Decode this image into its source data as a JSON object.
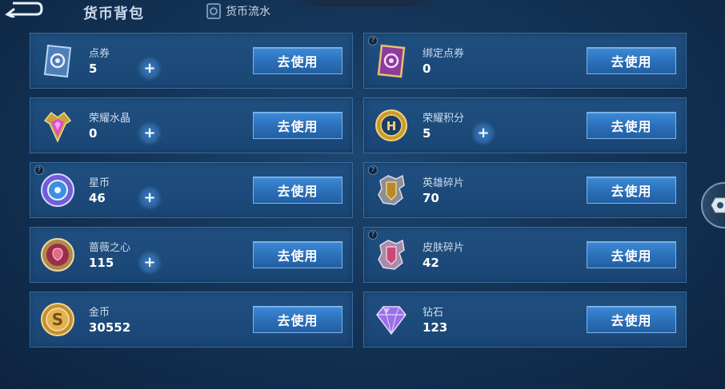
{
  "header": {
    "title": "货币背包",
    "flow_tab_label": "货币流水"
  },
  "use_label": "去使用",
  "currencies": [
    {
      "name": "点券",
      "amount": "5",
      "icon": "ticket-icon",
      "has_plus": true,
      "has_help": false
    },
    {
      "name": "绑定点券",
      "amount": "0",
      "icon": "bound-ticket-icon",
      "has_plus": false,
      "has_help": true
    },
    {
      "name": "荣耀水晶",
      "amount": "0",
      "icon": "glory-crystal-icon",
      "has_plus": true,
      "has_help": false
    },
    {
      "name": "荣耀积分",
      "amount": "5",
      "icon": "glory-points-icon",
      "has_plus": true,
      "has_help": false
    },
    {
      "name": "星币",
      "amount": "46",
      "icon": "star-coin-icon",
      "has_plus": true,
      "has_help": true
    },
    {
      "name": "英雄碎片",
      "amount": "70",
      "icon": "hero-shard-icon",
      "has_plus": false,
      "has_help": true
    },
    {
      "name": "蔷薇之心",
      "amount": "115",
      "icon": "rose-heart-icon",
      "has_plus": true,
      "has_help": false
    },
    {
      "name": "皮肤碎片",
      "amount": "42",
      "icon": "skin-shard-icon",
      "has_plus": false,
      "has_help": true
    },
    {
      "name": "金币",
      "amount": "30552",
      "icon": "gold-coin-icon",
      "has_plus": false,
      "has_help": false
    },
    {
      "name": "钻石",
      "amount": "123",
      "icon": "diamond-icon",
      "has_plus": false,
      "has_help": false
    }
  ],
  "colors": {
    "background": "#143457",
    "card": "#1f4f80",
    "button": "#2b6fb8",
    "accent": "#7bb6ee"
  }
}
